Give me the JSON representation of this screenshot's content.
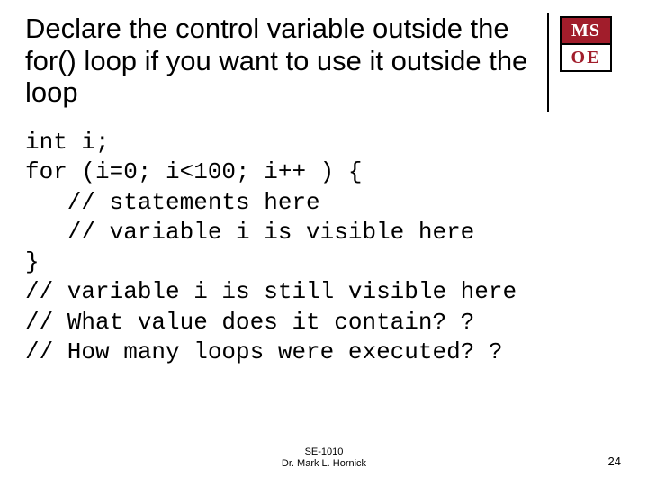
{
  "title": "Declare the control variable outside the for() loop if you want to use it outside the loop",
  "logo": {
    "top": "MS",
    "bottom": "OE"
  },
  "code": {
    "l1": "int i;",
    "l2": "for (i=0; i<100; i++ ) {",
    "l3": "   // statements here",
    "l4": "   // variable i is visible here",
    "l5": "}",
    "l6": "// variable i is still visible here",
    "l7": "// What value does it contain? ?",
    "l8": "// How many loops were executed? ?"
  },
  "footer": {
    "course": "SE-1010",
    "author": "Dr. Mark L. Hornick"
  },
  "page": "24"
}
